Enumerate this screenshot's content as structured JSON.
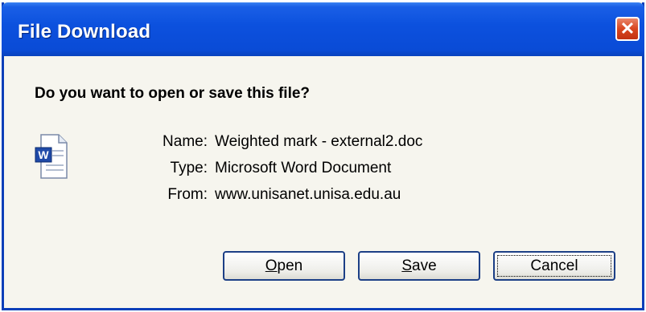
{
  "dialog": {
    "title": "File Download",
    "question": "Do you want to open or save this file?",
    "fields": [
      {
        "label": "Name:",
        "value": "Weighted mark - external2.doc"
      },
      {
        "label": "Type:",
        "value": "Microsoft Word Document"
      },
      {
        "label": "From:",
        "value": "www.unisanet.unisa.edu.au"
      }
    ],
    "buttons": {
      "open": {
        "accel": "O",
        "rest": "pen"
      },
      "save": {
        "accel": "S",
        "rest": "ave"
      },
      "cancel": "Cancel"
    },
    "icons": {
      "close": "close-icon",
      "file": "word-document-icon"
    },
    "colors": {
      "titlebar": "#0a4bd6",
      "close": "#d9461f",
      "body": "#f6f5ee",
      "button_border": "#1c3f86"
    }
  }
}
